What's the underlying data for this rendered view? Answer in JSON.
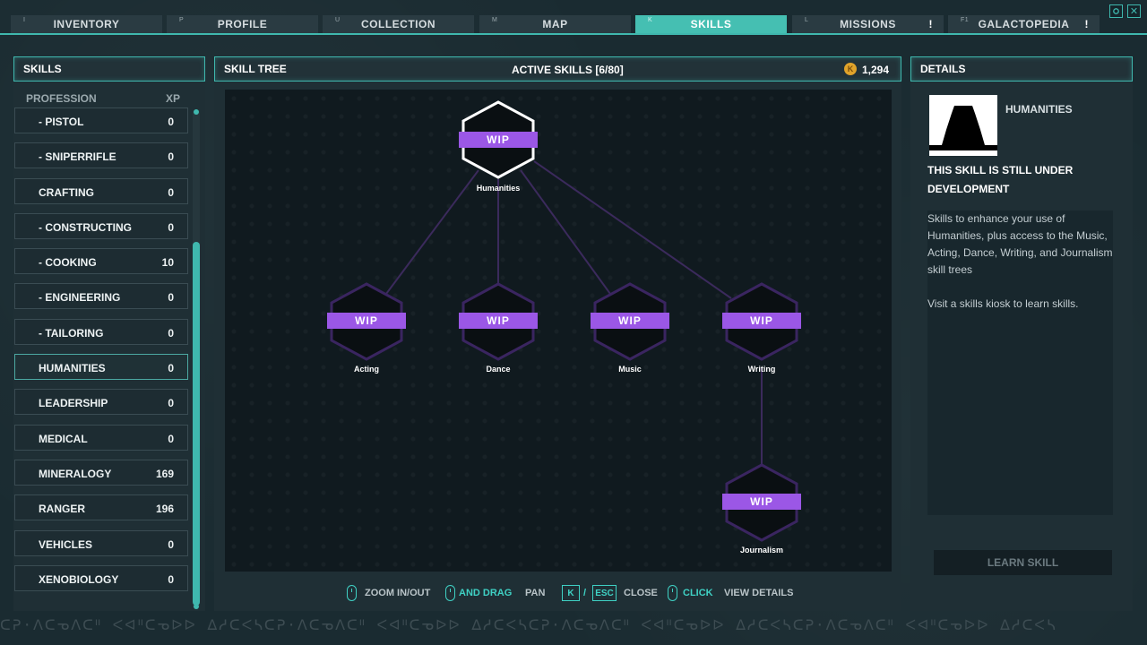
{
  "tabs": [
    {
      "key": "I",
      "label": "INVENTORY",
      "active": false,
      "alert": ""
    },
    {
      "key": "P",
      "label": "PROFILE",
      "active": false,
      "alert": ""
    },
    {
      "key": "U",
      "label": "COLLECTION",
      "active": false,
      "alert": ""
    },
    {
      "key": "M",
      "label": "MAP",
      "active": false,
      "alert": ""
    },
    {
      "key": "K",
      "label": "SKILLS",
      "active": true,
      "alert": ""
    },
    {
      "key": "L",
      "label": "MISSIONS",
      "active": false,
      "alert": "!"
    },
    {
      "key": "F1",
      "label": "GALACTOPEDIA",
      "active": false,
      "alert": "!"
    }
  ],
  "window_buttons": {
    "settings_icon": "gear-icon",
    "close_icon": "close-icon",
    "close_label": "✕"
  },
  "skills_panel": {
    "title": "SKILLS",
    "col_profession": "PROFESSION",
    "col_xp": "XP",
    "rows": [
      {
        "name": "- PISTOL",
        "xp": "0"
      },
      {
        "name": "- SNIPERRIFLE",
        "xp": "0"
      },
      {
        "name": "CRAFTING",
        "xp": "0"
      },
      {
        "name": "- CONSTRUCTING",
        "xp": "0"
      },
      {
        "name": "- COOKING",
        "xp": "10"
      },
      {
        "name": "- ENGINEERING",
        "xp": "0"
      },
      {
        "name": "- TAILORING",
        "xp": "0"
      },
      {
        "name": "HUMANITIES",
        "xp": "0"
      },
      {
        "name": "LEADERSHIP",
        "xp": "0"
      },
      {
        "name": "MEDICAL",
        "xp": "0"
      },
      {
        "name": "MINERALOGY",
        "xp": "169"
      },
      {
        "name": "RANGER",
        "xp": "196"
      },
      {
        "name": "VEHICLES",
        "xp": "0"
      },
      {
        "name": "XENOBIOLOGY",
        "xp": "0"
      }
    ],
    "selected_index": 7
  },
  "tree_panel": {
    "title": "SKILL TREE",
    "active_skills": "ACTIVE SKILLS [6/80]",
    "currency": "1,294",
    "currency_icon": "coin-icon",
    "badge": "WIP",
    "nodes": [
      {
        "id": "humanities",
        "label": "Humanities"
      },
      {
        "id": "acting",
        "label": "Acting"
      },
      {
        "id": "dance",
        "label": "Dance"
      },
      {
        "id": "music",
        "label": "Music"
      },
      {
        "id": "writing",
        "label": "Writing"
      },
      {
        "id": "journalism",
        "label": "Journalism"
      }
    ],
    "controls": {
      "zoom": "ZOOM IN/OUT",
      "and_drag": "AND DRAG",
      "pan": "PAN",
      "key_k": "K",
      "slash": "/",
      "key_esc": "ESC",
      "close": "CLOSE",
      "click": "CLICK",
      "view_details": "VIEW DETAILS"
    }
  },
  "details_panel": {
    "title": "DETAILS",
    "skill_name": "HUMANITIES",
    "dev_note": "THIS SKILL IS STILL UNDER DEVELOPMENT",
    "description": "Skills to enhance your use of Humanities, plus access to the Music, Acting, Dance, Writing, and Journalism skill trees",
    "hint": "Visit a skills kiosk to learn skills.",
    "learn_button": "LEARN SKILL",
    "image_icon": "theater-curtain-icon"
  },
  "footer_glyphs": "ᑕᕈ·ᐱᑕᓀᐱᑕᐦ ᐸᐊᐦᑕᓀᐅᐅ ᐃᓱᑕᐸᓴᑕᕈ·ᐱᑕᓀᐱᑕᐦ ᐸᐊᐦᑕᓀᐅᐅ ᐃᓱᑕᐸᓴᑕᕈ·ᐱᑕᓀᐱᑕᐦ ᐸᐊᐦᑕᓀᐅᐅ ᐃᓱᑕᐸᓴᑕᕈ·ᐱᑕᓀᐱᑕᐦ ᐸᐊᐦᑕᓀᐅᐅ ᐃᓱᑕᐸᓴ",
  "colors": {
    "accent": "#3fb8ae",
    "wip": "#9b57e6",
    "coin": "#e0a32a"
  }
}
